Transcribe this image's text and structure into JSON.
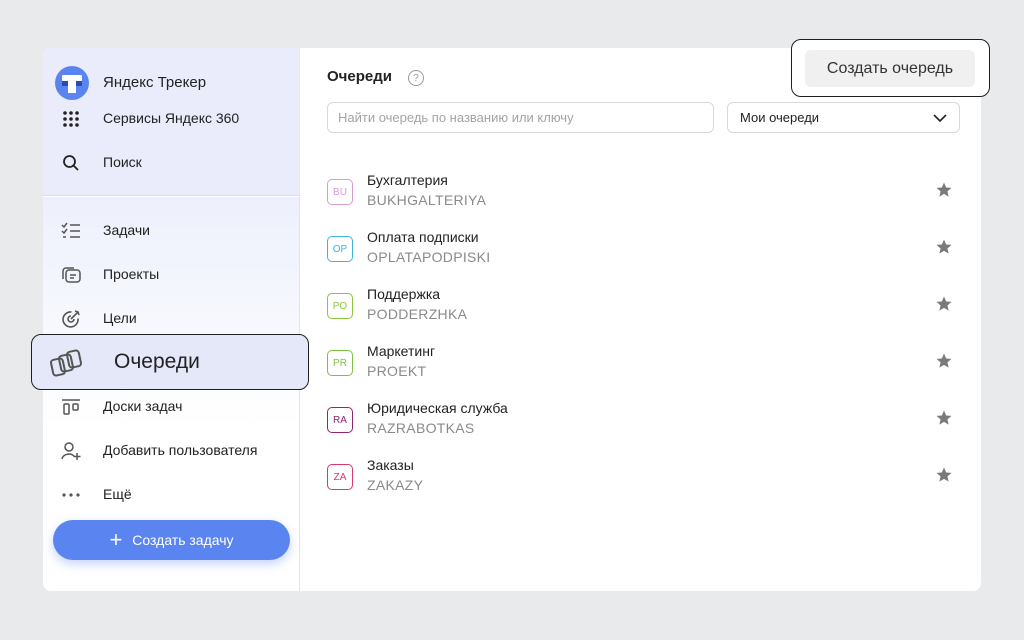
{
  "brand": {
    "title": "Яндекс Трекер"
  },
  "sidebar": {
    "top_items": [
      {
        "label": "Сервисы Яндекс 360",
        "icon": "apps-grid-icon"
      },
      {
        "label": "Поиск",
        "icon": "search-icon"
      }
    ],
    "items": [
      {
        "label": "Задачи",
        "icon": "tasks-icon"
      },
      {
        "label": "Проекты",
        "icon": "projects-icon"
      },
      {
        "label": "Цели",
        "icon": "goals-icon"
      },
      {
        "label": "Очереди",
        "icon": "queues-icon",
        "active": true
      },
      {
        "label": "Доски задач",
        "icon": "boards-icon"
      },
      {
        "label": "Добавить пользователя",
        "icon": "add-user-icon"
      },
      {
        "label": "Ещё",
        "icon": "more-icon"
      }
    ],
    "create_task_label": "Создать задачу"
  },
  "main": {
    "title": "Очереди",
    "create_queue_label": "Создать очередь",
    "search_placeholder": "Найти очередь по названию или ключу",
    "filter_value": "Мои очереди",
    "queues": [
      {
        "abbr": "BU",
        "name": "Бухгалтерия",
        "key": "BUKHGALTERIYA",
        "color": "#d99ad6"
      },
      {
        "abbr": "OP",
        "name": "Оплата подписки",
        "key": "OPLATAPODPISKI",
        "color": "#3fb3e0"
      },
      {
        "abbr": "PO",
        "name": "Поддержка",
        "key": "PODDERZHKA",
        "color": "#8cc63f"
      },
      {
        "abbr": "PR",
        "name": "Маркетинг",
        "key": "PROEKT",
        "color": "#7cc242"
      },
      {
        "abbr": "RA",
        "name": "Юридическая служба",
        "key": "RAZRABOTKAS",
        "color": "#8e2673"
      },
      {
        "abbr": "ZA",
        "name": "Заказы",
        "key": "ZAKAZY",
        "color": "#d8386b"
      }
    ]
  },
  "colors": {
    "accent": "#5a84f0",
    "star": "#7a7a7a",
    "sidebar_top": "#eaecfb"
  }
}
